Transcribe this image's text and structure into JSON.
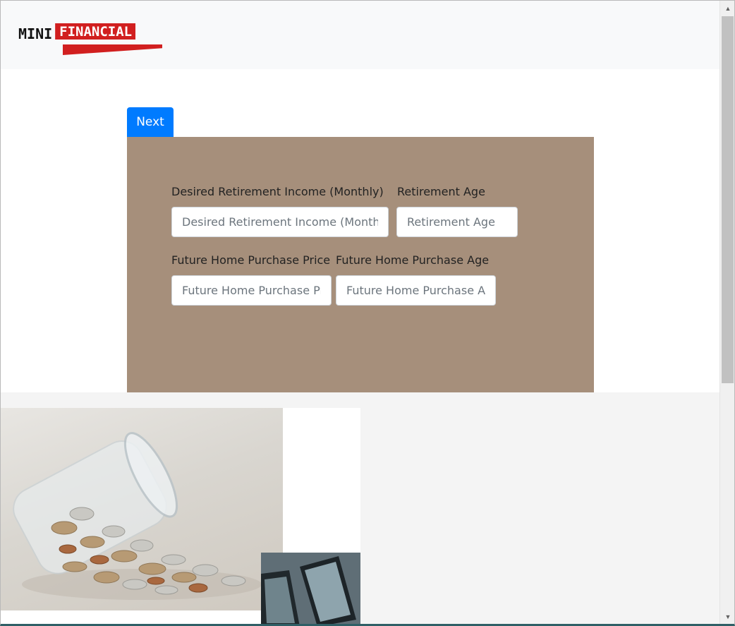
{
  "header": {
    "logo_left": "MINI",
    "logo_right": "FINANCIAL",
    "logo_brand_color": "#d11f1f"
  },
  "actions": {
    "next_label": "Next",
    "accent_color": "#007bff"
  },
  "form": {
    "panel_color": "#a68f7b",
    "retirement_income": {
      "label": "Desired Retirement Income (Monthly)",
      "placeholder": "Desired Retirement Income (Monthly)",
      "value": ""
    },
    "retirement_age": {
      "label": "Retirement Age",
      "placeholder": "Retirement Age",
      "value": ""
    },
    "home_price": {
      "label": "Future Home Purchase Price",
      "placeholder": "Future Home Purchase Price",
      "value": ""
    },
    "home_age": {
      "label": "Future Home Purchase Age",
      "placeholder": "Future Home Purchase Age",
      "value": ""
    }
  },
  "scrollbar": {
    "up_icon": "triangle-up-icon",
    "down_icon": "triangle-down-icon"
  }
}
